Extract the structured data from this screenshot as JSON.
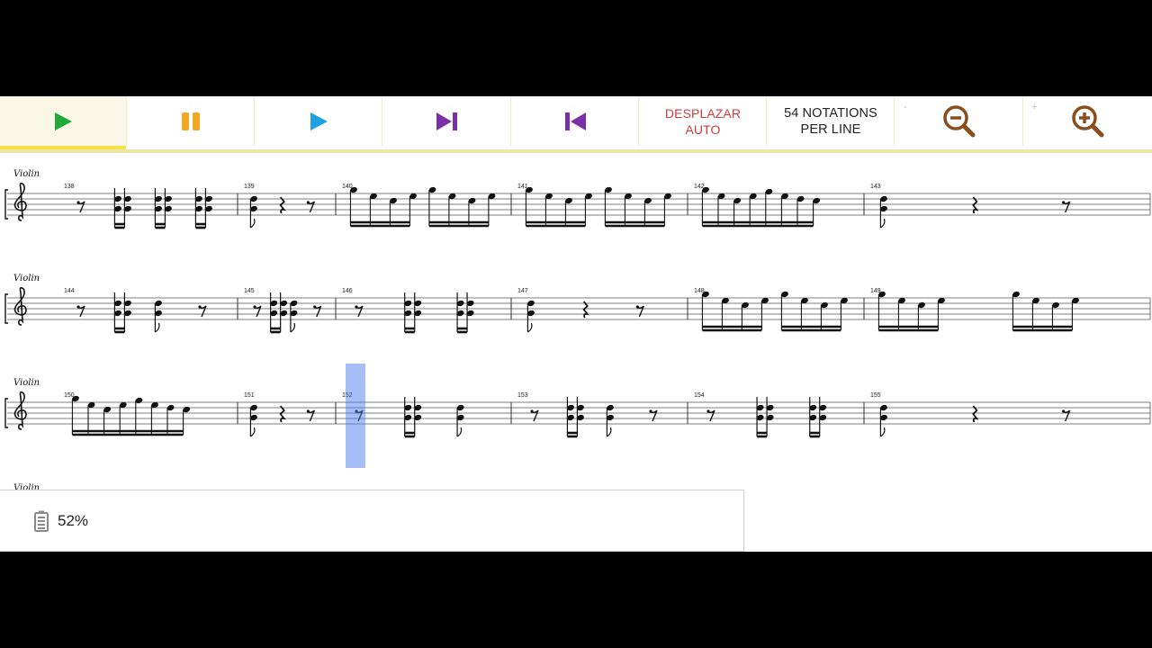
{
  "toolbar": {
    "buttons": [
      {
        "name": "play-button",
        "icon": "play-icon",
        "color": "#23a83a"
      },
      {
        "name": "pause-button",
        "icon": "pause-icon",
        "color": "#f5a623"
      },
      {
        "name": "play-selection-button",
        "icon": "play-icon",
        "color": "#1ea1e0"
      },
      {
        "name": "skip-next-button",
        "icon": "skip-next-icon",
        "color": "#7b2fa8"
      },
      {
        "name": "skip-previous-button",
        "icon": "skip-previous-icon",
        "color": "#7b2fa8"
      }
    ],
    "autoscroll_line1": "DESPLAZAR",
    "autoscroll_line2": "AUTO",
    "notations_line1": "54 NOTATIONS",
    "notations_line2": "PER LINE",
    "zoom_out_hint": "-",
    "zoom_in_hint": "+",
    "zoom_color": "#8a4d1c"
  },
  "score": {
    "instrument": "Violin",
    "playhead_measure": "152",
    "systems": [
      {
        "measures": [
          "138",
          "139",
          "140",
          "141",
          "142",
          "143"
        ]
      },
      {
        "measures": [
          "144",
          "145",
          "146",
          "147",
          "148",
          "149"
        ]
      },
      {
        "measures": [
          "150",
          "151",
          "152",
          "153",
          "154",
          "155"
        ]
      }
    ]
  },
  "status": {
    "battery_percent": "52%"
  }
}
